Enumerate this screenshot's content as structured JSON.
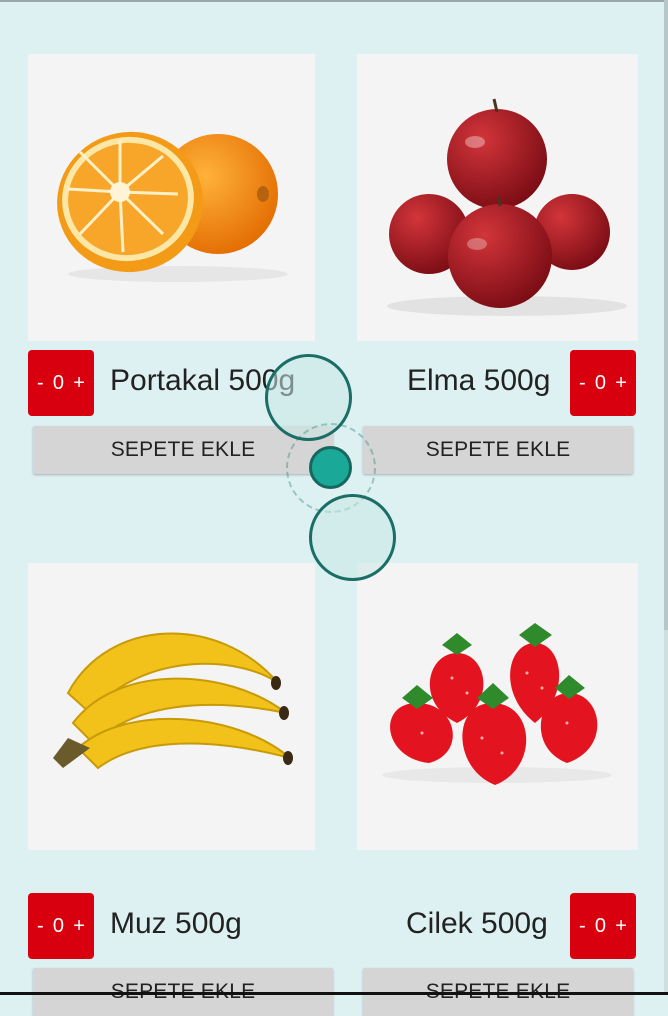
{
  "products": [
    {
      "name": "Portakal 500g",
      "qty": "0",
      "minus": "-",
      "plus": "+",
      "button": "SEPETE EKLE",
      "icon": "orange-image"
    },
    {
      "name": "Elma 500g",
      "qty": "0",
      "minus": "-",
      "plus": "+",
      "button": "SEPETE EKLE",
      "icon": "apple-image"
    },
    {
      "name": "Muz 500g",
      "qty": "0",
      "minus": "-",
      "plus": "+",
      "button": "SEPETE EKLE",
      "icon": "banana-image"
    },
    {
      "name": "Cilek 500g",
      "qty": "0",
      "minus": "-",
      "plus": "+",
      "button": "SEPETE EKLE",
      "icon": "strawberry-image"
    }
  ],
  "colors": {
    "background": "#ddf0f2",
    "stepper": "#d8000f",
    "button": "#d5d5d5",
    "touch_indicator": "#1aa898"
  }
}
